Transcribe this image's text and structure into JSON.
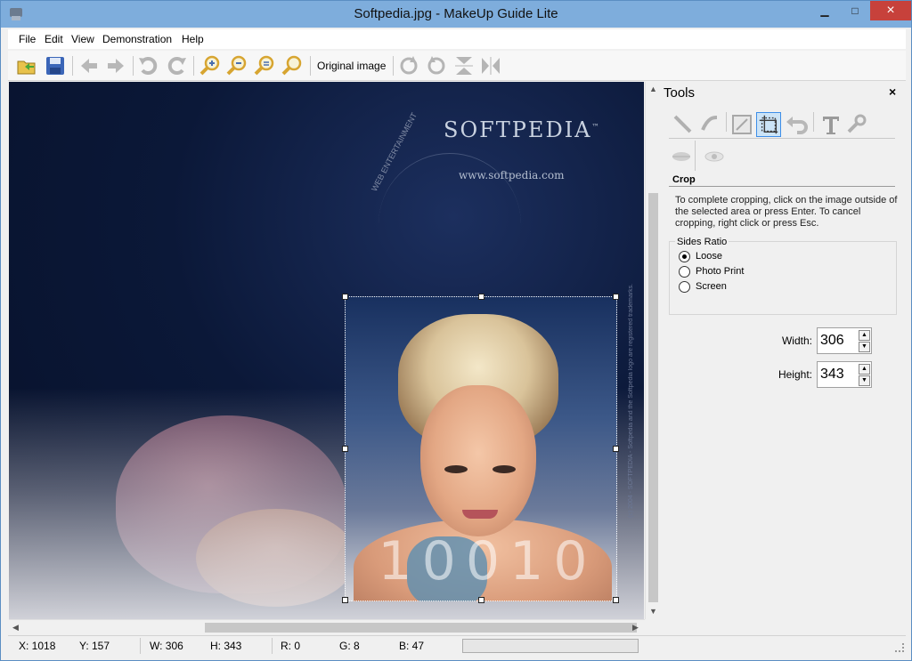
{
  "window": {
    "title": "Softpedia.jpg - MakeUp Guide Lite",
    "minimize": "▁",
    "maximize": "□",
    "close": "×"
  },
  "menu": [
    "File",
    "Edit",
    "View",
    "Demonstration",
    "Help"
  ],
  "toolbar": {
    "buttons": [
      "open-icon",
      "save-icon",
      "back-icon",
      "forward-icon",
      "undo-icon",
      "redo-icon",
      "zoom-in-icon",
      "zoom-out-icon",
      "zoom-fit-icon",
      "zoom-actual-icon",
      "rotate-right-icon",
      "rotate-left-icon",
      "flip-vertical-icon",
      "flip-horizontal-icon"
    ],
    "original_image_label": "Original image"
  },
  "image": {
    "brand": "SOFTPEDIA",
    "brand_tm": "™",
    "url": "www.softpedia.com",
    "arc": "WEB ENTERTAINMENT",
    "watermark": "(c) 2004 - SOFTPEDIA - Softpedia and the Softpedia logo are registered trademarks.",
    "digits": "1 0 0 1 0"
  },
  "tools": {
    "title": "Tools",
    "close": "×",
    "row1": [
      "brush-icon",
      "retouch-icon",
      "resize-icon",
      "crop-icon",
      "undo-tool-icon",
      "text-icon",
      "settings-wrench-icon"
    ],
    "row2": [
      "lips-icon",
      "eye-icon"
    ],
    "section": "Crop",
    "help": "To complete cropping, click on the image outside of the selected area or press Enter. To cancel cropping, right click or press Esc.",
    "sides_ratio_label": "Sides Ratio",
    "ratio_options": [
      {
        "label": "Loose",
        "checked": true
      },
      {
        "label": "Photo Print",
        "checked": false
      },
      {
        "label": "Screen",
        "checked": false
      }
    ],
    "width_label": "Width:",
    "width_value": "306",
    "height_label": "Height:",
    "height_value": "343"
  },
  "status": {
    "x": "X: 1018",
    "y": "Y: 157",
    "w": "W: 306",
    "h": "H: 343",
    "r": "R: 0",
    "g": "G: 8",
    "b": "B: 47"
  }
}
